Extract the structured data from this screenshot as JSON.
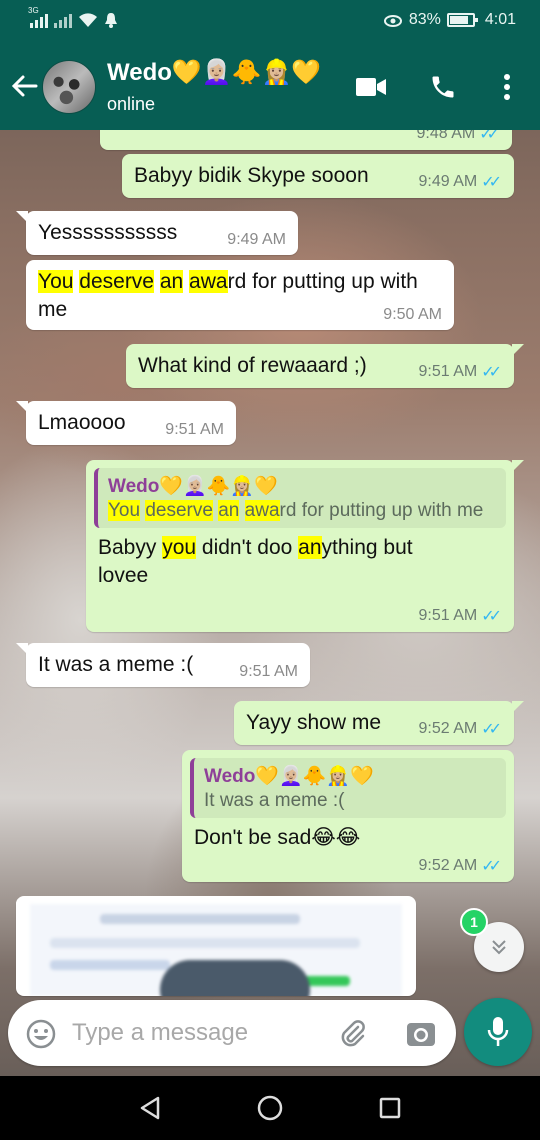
{
  "statusbar": {
    "network": "3G",
    "battery_percent": "83%",
    "time": "4:01"
  },
  "header": {
    "contact_name": "Wedo💛👩🏼‍🦳🐥👷🏼‍♀️💛",
    "status": "online"
  },
  "messages": [
    {
      "id": "m0",
      "direction": "out",
      "text": "",
      "time": "9:48 AM",
      "ticks": "✓✓"
    },
    {
      "id": "m1",
      "direction": "out",
      "text": "Babyy bidik Skype sooon",
      "time": "9:49 AM",
      "ticks": "✓✓"
    },
    {
      "id": "m2",
      "direction": "in",
      "text": "Yesssssssssss",
      "time": "9:49 AM"
    },
    {
      "id": "m3",
      "direction": "in",
      "segments": [
        "You",
        " ",
        "deserve",
        " ",
        "an",
        " ",
        "awa",
        "rd for putting up with me"
      ],
      "time": "9:50 AM"
    },
    {
      "id": "m4",
      "direction": "out",
      "text": "What kind of rewaaard ;)",
      "time": "9:51 AM",
      "ticks": "✓✓"
    },
    {
      "id": "m5",
      "direction": "in",
      "text": "Lmaoooo",
      "time": "9:51 AM"
    },
    {
      "id": "m6",
      "direction": "out",
      "quote": {
        "author": "Wedo💛👩🏼‍🦳🐥👷🏼‍♀️💛",
        "segments": [
          "You",
          " ",
          "deserve",
          " ",
          "an",
          " ",
          "awa",
          "rd for putting up with me"
        ]
      },
      "segments": [
        "Babyy ",
        "you",
        " didn't doo ",
        "an",
        "ything but lovee"
      ],
      "time": "9:51 AM",
      "ticks": "✓✓"
    },
    {
      "id": "m7",
      "direction": "in",
      "text": "It was a meme :(",
      "time": "9:51 AM"
    },
    {
      "id": "m8",
      "direction": "out",
      "text": "Yayy show me",
      "time": "9:52 AM",
      "ticks": "✓✓"
    },
    {
      "id": "m9",
      "direction": "out",
      "quote": {
        "author": "Wedo💛👩🏼‍🦳🐥👷🏼‍♀️💛",
        "text": "It was a meme :("
      },
      "text": "Don't be sad😂😂",
      "time": "9:52 AM",
      "ticks": "✓✓"
    }
  ],
  "scroll": {
    "unread_count": "1"
  },
  "composer": {
    "placeholder": "Type a message"
  },
  "colors": {
    "header": "#075e54",
    "outgoing_bubble": "#dcf8c6",
    "incoming_bubble": "#ffffff",
    "mic_button": "#128c7e",
    "read_ticks": "#34b7f1",
    "highlight": "#ffff00",
    "quote_author": "#8e3f98",
    "unread_badge": "#25d366"
  },
  "icons": {
    "back": "arrow-left-icon",
    "video": "video-call-icon",
    "call": "phone-icon",
    "menu": "more-vert-icon",
    "emoji": "emoji-icon",
    "attach": "paperclip-icon",
    "camera": "camera-icon",
    "mic": "mic-icon",
    "scroll_down": "double-chevron-down-icon"
  }
}
